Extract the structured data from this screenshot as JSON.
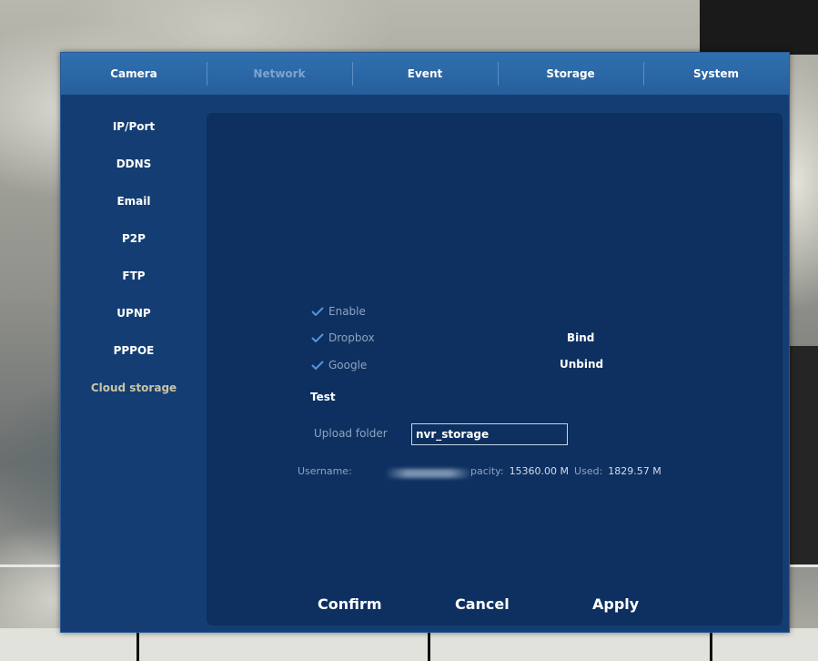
{
  "tabs": [
    {
      "label": "Camera",
      "active": false
    },
    {
      "label": "Network",
      "active": true
    },
    {
      "label": "Event",
      "active": false
    },
    {
      "label": "Storage",
      "active": false
    },
    {
      "label": "System",
      "active": false
    }
  ],
  "sidebar": {
    "items": [
      {
        "label": "IP/Port"
      },
      {
        "label": "DDNS"
      },
      {
        "label": "Email"
      },
      {
        "label": "P2P"
      },
      {
        "label": "FTP"
      },
      {
        "label": "UPNP"
      },
      {
        "label": "PPPOE"
      },
      {
        "label": "Cloud storage",
        "active": true
      }
    ]
  },
  "cloud": {
    "enable_label": "Enable",
    "enable_checked": true,
    "dropbox_label": "Dropbox",
    "dropbox_checked": true,
    "google_label": "Google",
    "google_checked": true,
    "bind_label": "Bind",
    "unbind_label": "Unbind",
    "test_label": "Test",
    "upload_folder_label": "Upload folder",
    "upload_folder_value": "nvr_storage",
    "username_label": "Username:",
    "capacity_label": "pacity:",
    "capacity_value": "15360.00 M",
    "used_label": "Used:",
    "used_value": "1829.57 M"
  },
  "buttons": {
    "confirm": "Confirm",
    "cancel": "Cancel",
    "apply": "Apply"
  },
  "colors": {
    "tabbar": "#2f70b0",
    "panel": "#143e73",
    "content": "#0d3060",
    "check": "#5a92d6",
    "active_tab_text": "#7ea3cf",
    "active_sidebar_text": "#c9c4a8"
  }
}
